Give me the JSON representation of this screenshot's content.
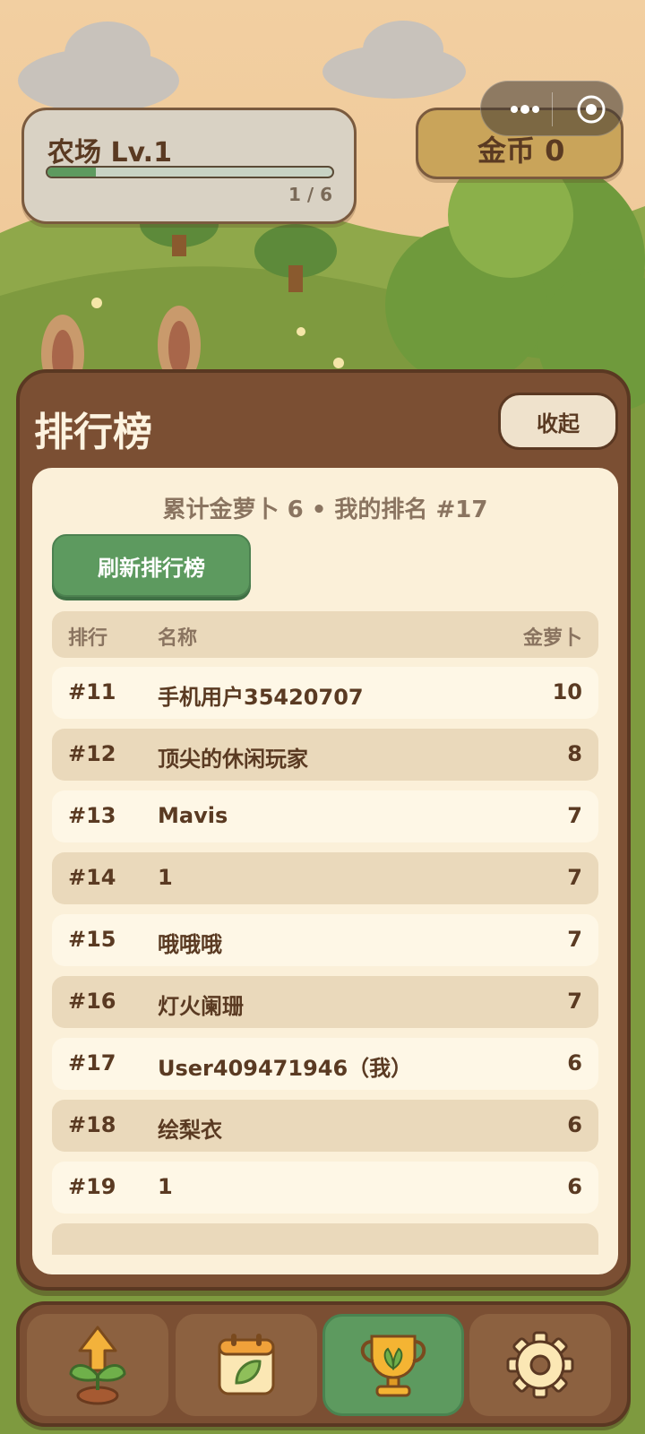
{
  "farm": {
    "title": "农场 Lv.1",
    "progress_text": "1 / 6",
    "progress_fraction": 0.17
  },
  "coins": {
    "label": "金币 0"
  },
  "leaderboard": {
    "title": "排行榜",
    "collapse_label": "收起",
    "summary": "累计金萝卜 6 • 我的排名 #17",
    "refresh_label": "刷新排行榜",
    "columns": {
      "rank": "排行",
      "name": "名称",
      "score": "金萝卜"
    },
    "rows": [
      {
        "rank": "#11",
        "name": "手机用户35420707",
        "score": "10"
      },
      {
        "rank": "#12",
        "name": "顶尖的休闲玩家",
        "score": "8"
      },
      {
        "rank": "#13",
        "name": "Mavis",
        "score": "7"
      },
      {
        "rank": "#14",
        "name": "1",
        "score": "7"
      },
      {
        "rank": "#15",
        "name": "哦哦哦",
        "score": "7"
      },
      {
        "rank": "#16",
        "name": "灯火阑珊",
        "score": "7"
      },
      {
        "rank": "#17",
        "name": "User409471946（我）",
        "score": "6"
      },
      {
        "rank": "#18",
        "name": "绘梨衣",
        "score": "6"
      },
      {
        "rank": "#19",
        "name": "1",
        "score": "6"
      }
    ]
  },
  "nav": {
    "items": [
      {
        "icon": "sprout-upgrade-icon"
      },
      {
        "icon": "calendar-icon"
      },
      {
        "icon": "trophy-icon",
        "active": true
      },
      {
        "icon": "gear-icon"
      }
    ]
  }
}
